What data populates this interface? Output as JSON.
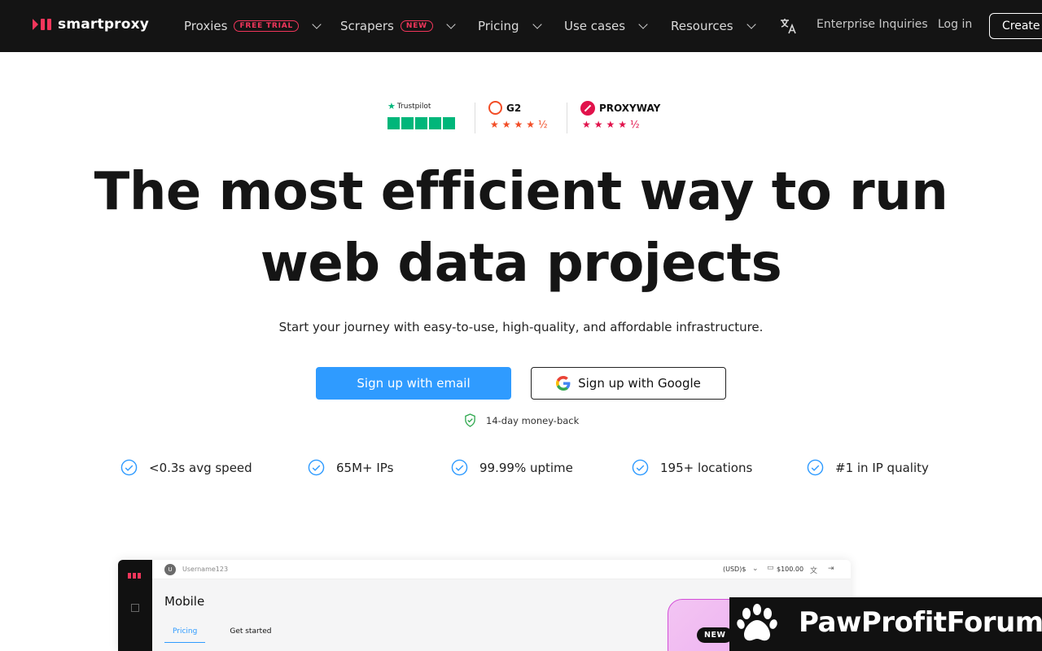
{
  "header": {
    "logo_text": "smartproxy",
    "nav": [
      {
        "label": "Proxies",
        "badge": "FREE TRIAL"
      },
      {
        "label": "Scrapers",
        "badge": "NEW"
      },
      {
        "label": "Pricing"
      },
      {
        "label": "Use cases"
      },
      {
        "label": "Resources"
      }
    ],
    "enterprise_label": "Enterprise Inquiries",
    "login_label": "Log in",
    "create_label": "Create account"
  },
  "ratings": {
    "trustpilot_label": "Trustpilot",
    "trustpilot_stars": 5,
    "g2_label": "G2",
    "g2_stars": 4.5,
    "proxyway_label": "PROXYWAY",
    "proxyway_stars": 4.5
  },
  "hero": {
    "headline_line1": "The most efficient way to run",
    "headline_line2": "web data projects",
    "subheadline": "Start your journey with easy-to-use, high-quality, and affordable infrastructure.",
    "signup_email_label": "Sign up with email",
    "signup_google_label": "Sign up with Google",
    "money_back": "14-day money-back"
  },
  "features": [
    "<0.3s avg speed",
    "65M+ IPs",
    "99.99% uptime",
    "195+ locations",
    "#1 in IP quality"
  ],
  "dashboard_preview": {
    "avatar_initial": "U",
    "username": "Username123",
    "currency": "(USD)$",
    "balance": "$100.00",
    "title": "Mobile",
    "tabs": [
      "Pricing",
      "Get started"
    ],
    "new_badge": "NEW"
  },
  "watermark": {
    "text": "PawProfitForum"
  },
  "colors": {
    "brand_red": "#f2365b",
    "primary_blue": "#2f9bff",
    "trustpilot_green": "#00b67a",
    "g2_orange": "#f24d26",
    "proxyway_pink": "#e1124b",
    "header_bg": "#141414"
  }
}
